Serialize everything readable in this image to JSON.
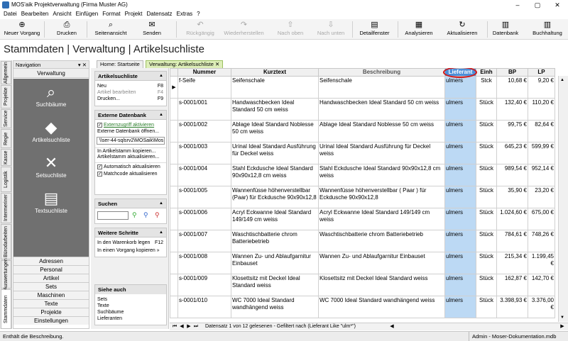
{
  "window": {
    "title": "MOS'aik Projektverwaltung (Firma Muster AG)",
    "minimize": "–",
    "maximize": "▢",
    "close": "✕"
  },
  "menu": [
    "Datei",
    "Bearbeiten",
    "Ansicht",
    "Einfügen",
    "Format",
    "Projekt",
    "Datensatz",
    "Extras",
    "?"
  ],
  "toolbar": [
    {
      "label": "Neuer Vorgang",
      "icon": "⊕",
      "enabled": true
    },
    {
      "label": "Drucken",
      "icon": "⎙",
      "enabled": true
    },
    {
      "label": "Seitenansicht",
      "icon": "⌕",
      "enabled": true
    },
    {
      "label": "Senden",
      "icon": "✉",
      "enabled": true
    },
    {
      "label": "Rückgängig",
      "icon": "↶",
      "enabled": false
    },
    {
      "label": "Wiederherstellen",
      "icon": "↷",
      "enabled": false
    },
    {
      "label": "Nach oben",
      "icon": "⇧",
      "enabled": false
    },
    {
      "label": "Nach unten",
      "icon": "⇩",
      "enabled": false
    },
    {
      "label": "Detailfenster",
      "icon": "▤",
      "enabled": true
    },
    {
      "label": "Analysieren",
      "icon": "▦",
      "enabled": true
    },
    {
      "label": "Aktualisieren",
      "icon": "↻",
      "enabled": true
    },
    {
      "label": "Datenbank",
      "icon": "▥",
      "enabled": true
    },
    {
      "label": "Buchhaltung",
      "icon": "▥",
      "enabled": true
    }
  ],
  "header": {
    "title": "Stammdaten | Verwaltung | Artikelsuchliste"
  },
  "vtabs": [
    "Allgemein",
    "Projekte",
    "Service",
    "Regie",
    "Kasse",
    "Logistik",
    "Intermeriner",
    "Bürodarbeiten",
    "Auswertungen",
    "Stammdaten"
  ],
  "nav": {
    "title": "Navigation",
    "pin": "▾ ✕",
    "section": "Verwaltung",
    "items": [
      {
        "label": "Suchbäume",
        "icon": "⌕"
      },
      {
        "label": "Artikelsuchliste",
        "icon": "◆"
      },
      {
        "label": "Setsuchliste",
        "icon": "✕"
      },
      {
        "label": "Textsuchliste",
        "icon": "▤"
      }
    ],
    "list": [
      "Adressen",
      "Personal",
      "Artikel",
      "Sets",
      "Maschinen",
      "Texte",
      "Projekte",
      "Einstellungen"
    ]
  },
  "tabs": [
    {
      "label": "Home: Startseite"
    },
    {
      "label": "Verwaltung: Artikelsuchliste",
      "close": "✕"
    }
  ],
  "side": {
    "artikel": {
      "title": "Artikelsuchliste",
      "rows": [
        {
          "label": "Neu",
          "key": "F8"
        },
        {
          "label": "Artikel bearbeiten",
          "key": "F4"
        },
        {
          "label": "Drucken...",
          "key": "F9"
        }
      ]
    },
    "extern": {
      "title": "Externe Datenbank",
      "check": "Externzugriff aktivieren",
      "open": "Externe Datenbank öffnen...",
      "path": "\\\\ser-44-sqlsrv2\\MOSaik\\Mos",
      "take": "In Artikelstamm kopieren...",
      "upd": "Artikelstamm aktualisieren...",
      "auto": "Automatisch aktualisieren",
      "match": "Matchcode aktualisieren"
    },
    "suchen": {
      "title": "Suchen"
    },
    "weitere": {
      "title": "Weitere Schritte",
      "r1": "In den Warenkorb legen",
      "k1": "F12",
      "r2": "In einen Vorgang kopieren »"
    },
    "siehe": {
      "title": "Siehe auch",
      "rows": [
        "Sets",
        "Texte",
        "Suchbäume",
        "Lieferanten"
      ]
    }
  },
  "grid": {
    "columns": [
      "Nummer",
      "Kurztext",
      "Beschreibung",
      "Lieferant",
      "Einh",
      "BP",
      "LP"
    ],
    "rows": [
      [
        "f-Seife",
        "Seifenschale",
        "Seifenschale",
        "ulmers",
        "Stck",
        "10,68 €",
        "9,20 €"
      ],
      [
        "s-0001/001",
        "Handwaschbecken Ideal Standard 50 cm weiss",
        "Handwaschbecken Ideal Standard 50 cm weiss",
        "ulmers",
        "Stück",
        "132,40 €",
        "110,20 €"
      ],
      [
        "s-0001/002",
        "Ablage Ideal Standard Noblesse 50 cm weiss",
        "Ablage Ideal Standard Noblesse 50 cm weiss",
        "ulmers",
        "Stück",
        "99,75 €",
        "82,64 €"
      ],
      [
        "s-0001/003",
        "Urinal Ideal Standard Ausführung für Deckel weiss",
        "Urinal Ideal Standard Ausführung für Deckel weiss",
        "ulmers",
        "Stück",
        "645,23 €",
        "599,99 €"
      ],
      [
        "s-0001/004",
        "Stahl Eckdusche Ideal Standard 90x90x12,8 cm weiss",
        "Stahl Eckdusche Ideal Standard 90x90x12,8 cm weiss",
        "ulmers",
        "Stück",
        "989,54 €",
        "952,14 €"
      ],
      [
        "s-0001/005",
        "Wannenfüsse höhenverstellbar (Paar) für Eckdusche 90x90x12,8",
        "Wannenfüsse höhenverstellbar ( Paar ) für Eckdusche 90x90x12,8",
        "ulmers",
        "Stück",
        "35,90 €",
        "23,20 €"
      ],
      [
        "s-0001/006",
        "Acryl Eckwanne Ideal Standard 149/149 cm weiss",
        "Acryl Eckwanne Ideal Standard 149/149 cm weiss",
        "ulmers",
        "Stück",
        "1.024,60 €",
        "675,00 €"
      ],
      [
        "s-0001/007",
        "Waschtischbatterie chrom Batteriebetrieb",
        "Waschtischbatterie chrom Batteriebetrieb",
        "ulmers",
        "Stück",
        "784,61 €",
        "748,26 €"
      ],
      [
        "s-0001/008",
        "Wannen Zu- und Ablaufgarnitur Einbauset",
        "Wannen Zu- und Ablaufgarnitur Einbauset",
        "ulmers",
        "Stück",
        "215,34 €",
        "1.199,45 €"
      ],
      [
        "s-0001/009",
        "Klosettsitz mit Deckel Ideal Standard weiss",
        "Klosettsitz mit Deckel Ideal Standard weiss",
        "ulmers",
        "Stück",
        "162,87 €",
        "142,70 €"
      ],
      [
        "s-0001/010",
        "WC 7000 Ideal Standard wandhängend weiss",
        "WC 7000 Ideal Standard wandhängend weiss",
        "ulmers",
        "Stück",
        "3.398,93 €",
        "3.376,00 €"
      ]
    ]
  },
  "navbar": {
    "text": "Datensatz 1 von 12 gelesenen - Gefiltert nach (Lieferant Like \"ulm*\")"
  },
  "status": {
    "left": "Enthält die Beschreibung.",
    "right": "Admin - Moser-Dokumentation.mdb"
  }
}
